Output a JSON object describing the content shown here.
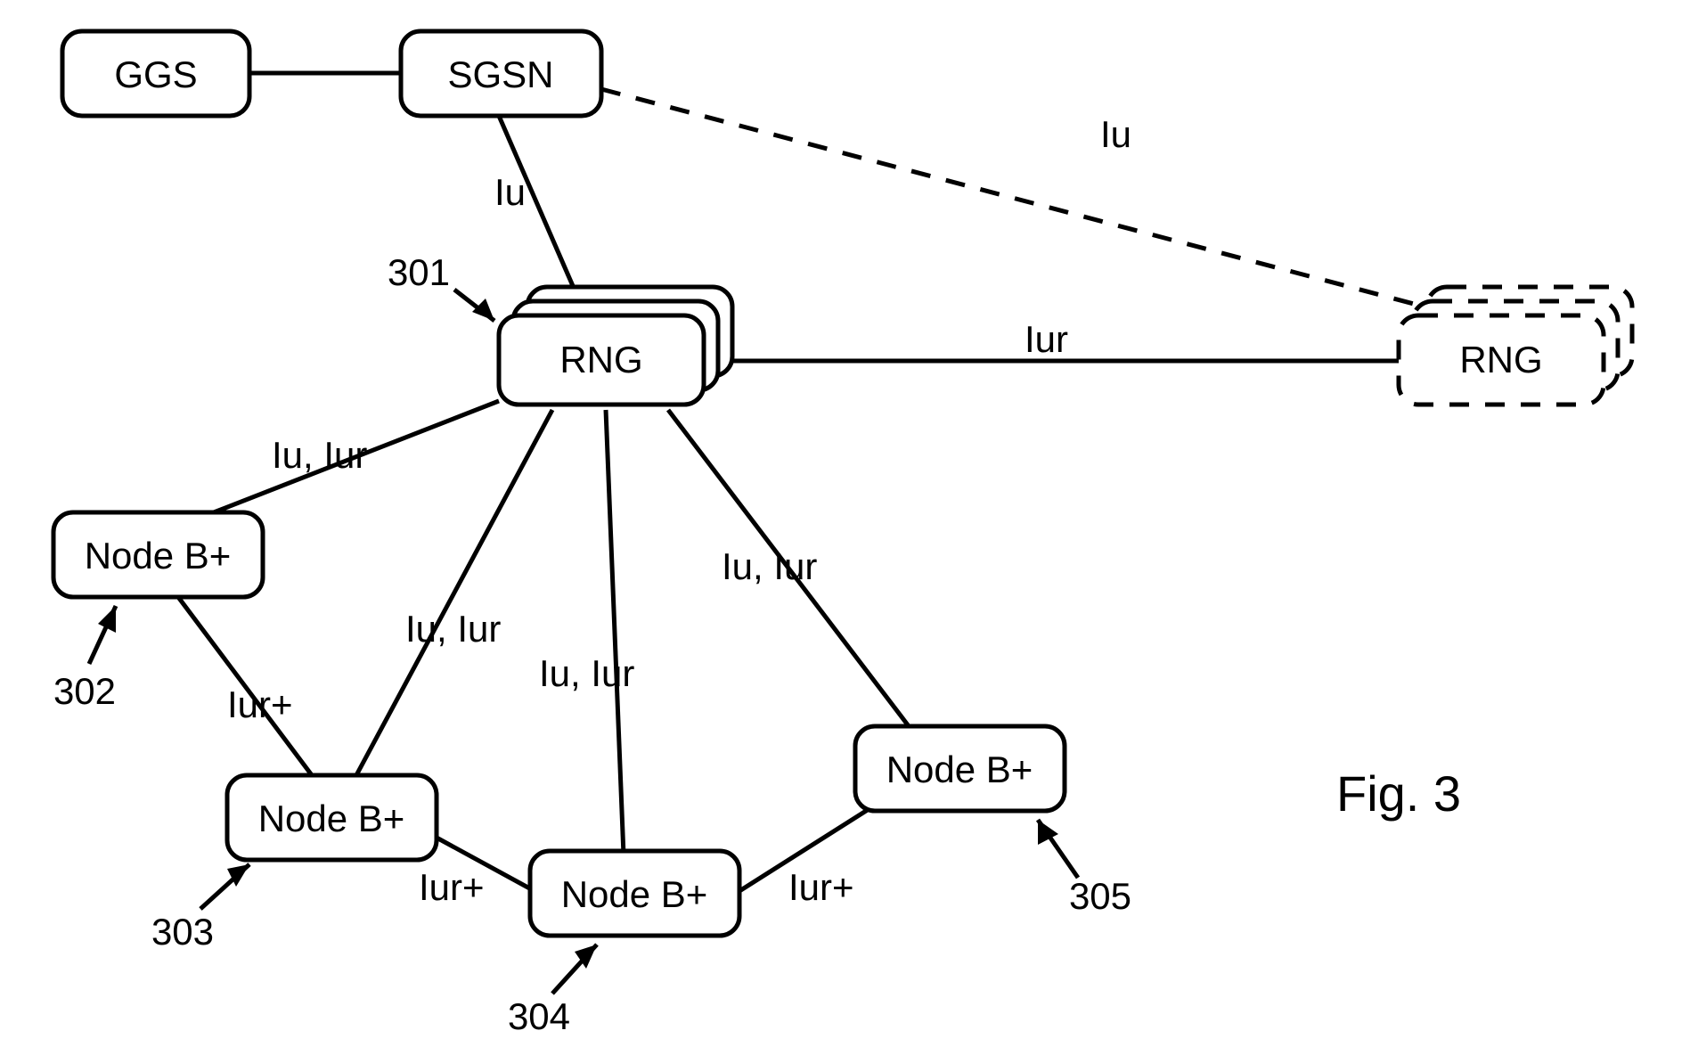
{
  "nodes": {
    "ggs": {
      "label": "GGS"
    },
    "sgsn": {
      "label": "SGSN"
    },
    "rng_left": {
      "label": "RNG"
    },
    "rng_right": {
      "label": "RNG"
    },
    "nodeb_302": {
      "label": "Node B+"
    },
    "nodeb_303": {
      "label": "Node B+"
    },
    "nodeb_304": {
      "label": "Node B+"
    },
    "nodeb_305": {
      "label": "Node B+"
    }
  },
  "edge_labels": {
    "sgsn_rng_left": "Iu",
    "sgsn_rng_right": "Iu",
    "rng_rng": "Iur",
    "rng_302": "Iu, Iur",
    "rng_303": "Iu, Iur",
    "rng_304": "Iu, Iur",
    "rng_305": "Iu, Iur",
    "302_303": "Iur+",
    "303_304": "Iur+",
    "304_305": "Iur+"
  },
  "callouts": {
    "rng_left": "301",
    "nodeb_302": "302",
    "nodeb_303": "303",
    "nodeb_304": "304",
    "nodeb_305": "305"
  },
  "figure_label": "Fig. 3"
}
